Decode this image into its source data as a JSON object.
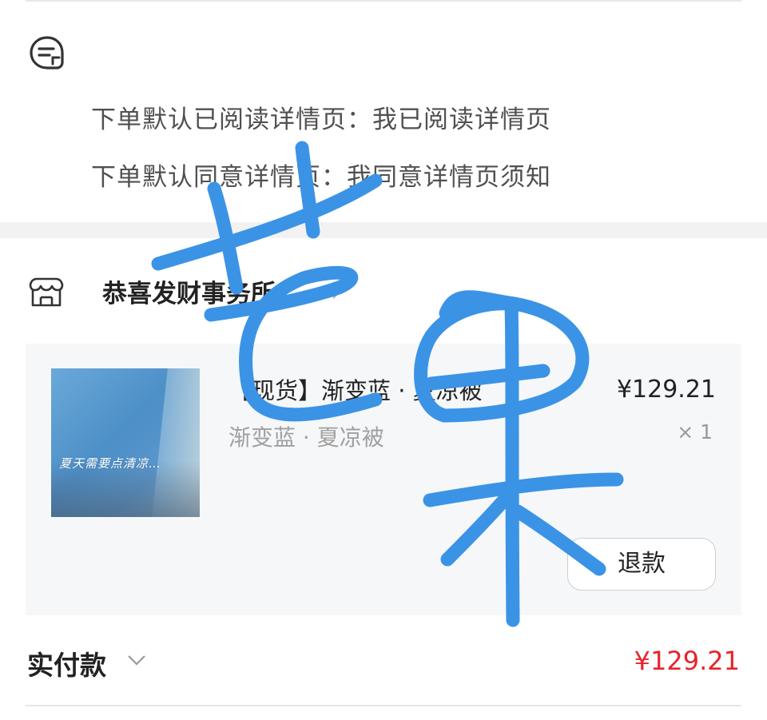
{
  "notes": {
    "icon": "note-bubble-icon",
    "line1": "下单默认已阅读详情页：我已阅读详情页",
    "line2": "下单默认同意详情页：我同意详情页须知"
  },
  "store": {
    "icon": "store-icon",
    "name": "恭喜发财事务所",
    "chevron": "chevron-right-icon"
  },
  "item": {
    "image_caption": "夏天需要点清凉…",
    "title": "【现货】渐变蓝 · 夏凉被",
    "spec": "渐变蓝 · 夏凉被",
    "price": "¥129.21",
    "quantity": "× 1",
    "refund_label": "退款"
  },
  "payment": {
    "label": "实付款",
    "chevron": "chevron-down-icon",
    "amount": "¥129.21"
  },
  "overlay": {
    "handwriting": "芒果",
    "color": "#3b93e6"
  },
  "colors": {
    "price_red": "#e8232b",
    "separator": "#f2f2f2",
    "card_bg": "#f6f7f9"
  }
}
